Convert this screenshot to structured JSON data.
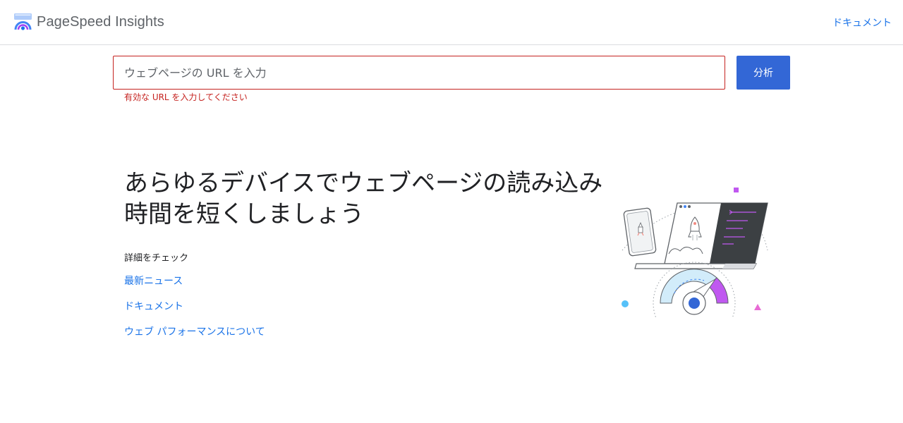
{
  "header": {
    "app_title": "PageSpeed Insights",
    "doc_link": "ドキュメント"
  },
  "search": {
    "placeholder": "ウェブページの URL を入力",
    "value": "",
    "error": "有効な URL を入力してください",
    "button_label": "分析"
  },
  "hero": {
    "title": "あらゆるデバイスでウェブページの読み込み時間を短くしましょう"
  },
  "learn_more": {
    "label": "詳細をチェック",
    "links": [
      "最新ニュース",
      "ドキュメント",
      "ウェブ パフォーマンスについて"
    ]
  },
  "colors": {
    "accent_blue": "#1a73e8",
    "button_blue": "#3367d6",
    "error_red": "#c5221f",
    "purple": "#c058f0",
    "light_blue": "#56c1f9"
  },
  "icons": [
    "pagespeed-logo-icon",
    "hero-illustration"
  ]
}
